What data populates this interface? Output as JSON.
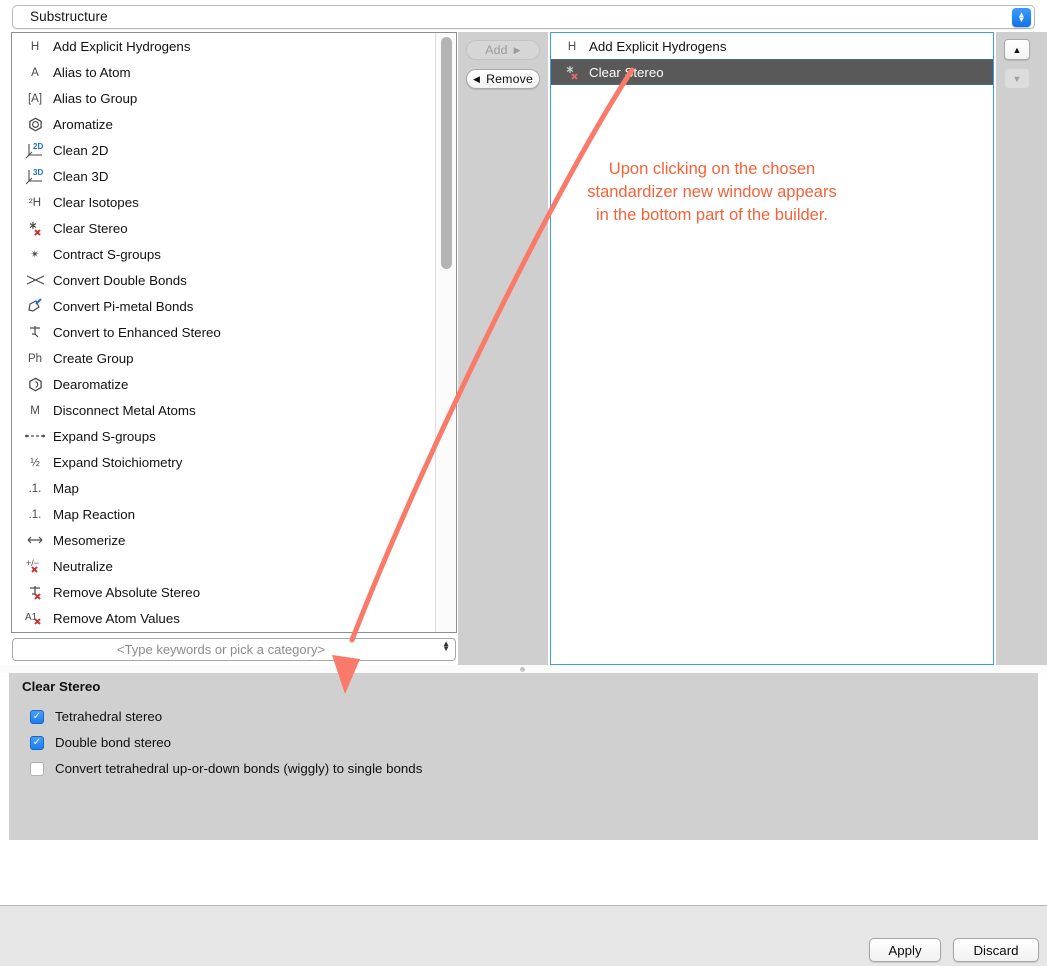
{
  "window": {
    "title": "Substructure"
  },
  "top_combo": {
    "value": "Substructure",
    "stepper_up": "▲",
    "stepper_down": "▼"
  },
  "available_list": {
    "items": [
      {
        "icon": "hydrogen-h-icon",
        "icon_text": "H",
        "label": "Add Explicit Hydrogens"
      },
      {
        "icon": "alias-atom-a-icon",
        "icon_text": "A",
        "label": "Alias to Atom"
      },
      {
        "icon": "alias-group-bracket-a-icon",
        "icon_text": "[A]",
        "label": "Alias to Group"
      },
      {
        "icon": "aromatize-hexagon-icon",
        "icon_text": "",
        "label": "Aromatize"
      },
      {
        "icon": "clean-2d-axes-icon",
        "icon_text": "2D",
        "label": "Clean 2D"
      },
      {
        "icon": "clean-3d-axes-icon",
        "icon_text": "3D",
        "label": "Clean 3D"
      },
      {
        "icon": "clear-isotopes-2h-icon",
        "icon_text": "²H",
        "label": "Clear Isotopes"
      },
      {
        "icon": "clear-stereo-star-x-icon",
        "icon_text": "",
        "label": "Clear Stereo"
      },
      {
        "icon": "contract-sgroups-dot-icon",
        "icon_text": "✴",
        "label": "Contract S-groups"
      },
      {
        "icon": "convert-double-bonds-icon",
        "icon_text": "",
        "label": "Convert Double Bonds"
      },
      {
        "icon": "convert-pi-metal-bonds-icon",
        "icon_text": "",
        "label": "Convert Pi-metal Bonds"
      },
      {
        "icon": "enhanced-stereo-icon",
        "icon_text": "",
        "label": "Convert to Enhanced Stereo"
      },
      {
        "icon": "create-group-ph-icon",
        "icon_text": "Ph",
        "label": "Create Group"
      },
      {
        "icon": "dearomatize-hexagon-icon",
        "icon_text": "",
        "label": "Dearomatize"
      },
      {
        "icon": "disconnect-metal-m-icon",
        "icon_text": "M",
        "label": "Disconnect Metal Atoms"
      },
      {
        "icon": "expand-sgroups-icon",
        "icon_text": "",
        "label": "Expand S-groups"
      },
      {
        "icon": "expand-stoichiometry-icon",
        "icon_text": "½",
        "label": "Expand Stoichiometry"
      },
      {
        "icon": "map-icon",
        "icon_text": ".1.",
        "label": "Map"
      },
      {
        "icon": "map-reaction-icon",
        "icon_text": ".1.",
        "label": "Map Reaction"
      },
      {
        "icon": "mesomerize-arrow-icon",
        "icon_text": "↔",
        "label": "Mesomerize"
      },
      {
        "icon": "neutralize-plus-minus-x-icon",
        "icon_text": "+/−",
        "label": "Neutralize"
      },
      {
        "icon": "remove-absolute-stereo-icon",
        "icon_text": "",
        "label": "Remove Absolute Stereo"
      },
      {
        "icon": "remove-atom-values-a1-icon",
        "icon_text": "A1",
        "label": "Remove Atom Values"
      }
    ]
  },
  "search": {
    "placeholder": "<Type keywords or pick a category>",
    "value": ""
  },
  "transfer_buttons": {
    "add_label": "Add",
    "add_glyph": "▶",
    "add_enabled": false,
    "remove_label": "Remove",
    "remove_glyph": "◀",
    "remove_enabled": true
  },
  "selected_list": {
    "items": [
      {
        "icon": "hydrogen-h-icon",
        "icon_text": "H",
        "label": "Add Explicit Hydrogens",
        "selected": false
      },
      {
        "icon": "clear-stereo-star-x-icon",
        "icon_text": "",
        "label": "Clear Stereo",
        "selected": true
      }
    ]
  },
  "order_buttons": {
    "up_glyph": "▲",
    "down_glyph": "▼",
    "up_enabled": true,
    "down_enabled": false
  },
  "options_panel": {
    "title": "Clear Stereo",
    "checkboxes": [
      {
        "label": "Tetrahedral stereo",
        "checked": true
      },
      {
        "label": "Double bond stereo",
        "checked": true
      },
      {
        "label": "Convert tetrahedral up-or-down bonds (wiggly) to single bonds",
        "checked": false
      }
    ],
    "check_glyph": "✓"
  },
  "footer": {
    "apply_label": "Apply",
    "discard_label": "Discard"
  },
  "annotation": {
    "line1": "Upon clicking on the chosen",
    "line2": "standardizer new window appears",
    "line3": "in the bottom part of the builder.",
    "color": "#f4623a"
  },
  "colors": {
    "accent_blue": "#1c7ef0",
    "panel_border_focus": "#3d9bf0",
    "selection_row": "#595959",
    "panel_grey": "#cfcfcf",
    "options_grey": "#d0d0d0",
    "footer_grey": "#e6e6e6",
    "annotation_orange": "#f4623a"
  }
}
